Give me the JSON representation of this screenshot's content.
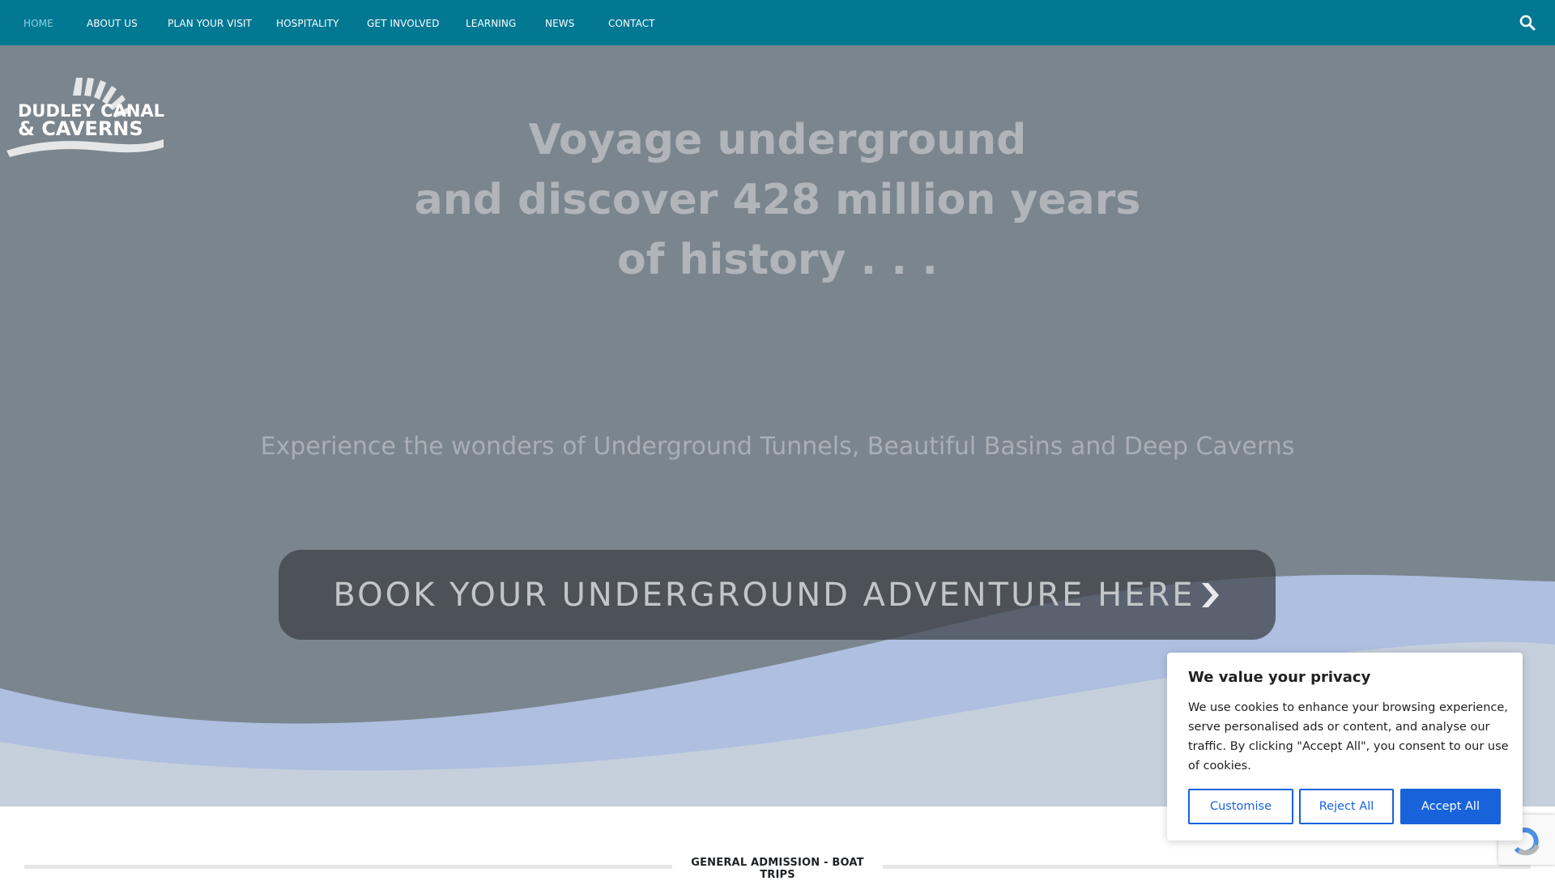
{
  "nav": {
    "items": [
      {
        "label": "HOME",
        "active": true
      },
      {
        "label": "ABOUT US"
      },
      {
        "label": "PLAN YOUR VISIT"
      },
      {
        "label": "HOSPITALITY"
      },
      {
        "label": "GET INVOLVED"
      },
      {
        "label": "LEARNING"
      },
      {
        "label": "NEWS"
      },
      {
        "label": "CONTACT"
      }
    ],
    "search_icon": "search-icon"
  },
  "logo": {
    "line1": "DUDLEY CANAL",
    "line2": "& CAVERNS"
  },
  "hero": {
    "headline_line1": "Voyage underground",
    "headline_line2": "and discover 428 million years",
    "headline_line3": "of history . . .",
    "tagline": "Experience the wonders of Underground Tunnels, Beautiful Basins and Deep Caverns",
    "cta_label": "BOOK YOUR UNDERGROUND ADVENTURE HERE",
    "cta_icon": "chevron-right-icon"
  },
  "section": {
    "title": "GENERAL ADMISSION - BOAT TRIPS"
  },
  "cookie": {
    "title": "We value your privacy",
    "text": "We use cookies to enhance your browsing experience, serve personalised ads or content, and analyse our traffic. By clicking \"Accept All\", you consent to our use of cookies.",
    "customise": "Customise",
    "reject": "Reject All",
    "accept": "Accept All"
  },
  "colors": {
    "nav_bg": "#027893",
    "hero_overlay": "#7b858d",
    "wave_light": "#aebfe0",
    "wave_pale": "#c6cfdc",
    "accent_blue": "#1863dc"
  }
}
